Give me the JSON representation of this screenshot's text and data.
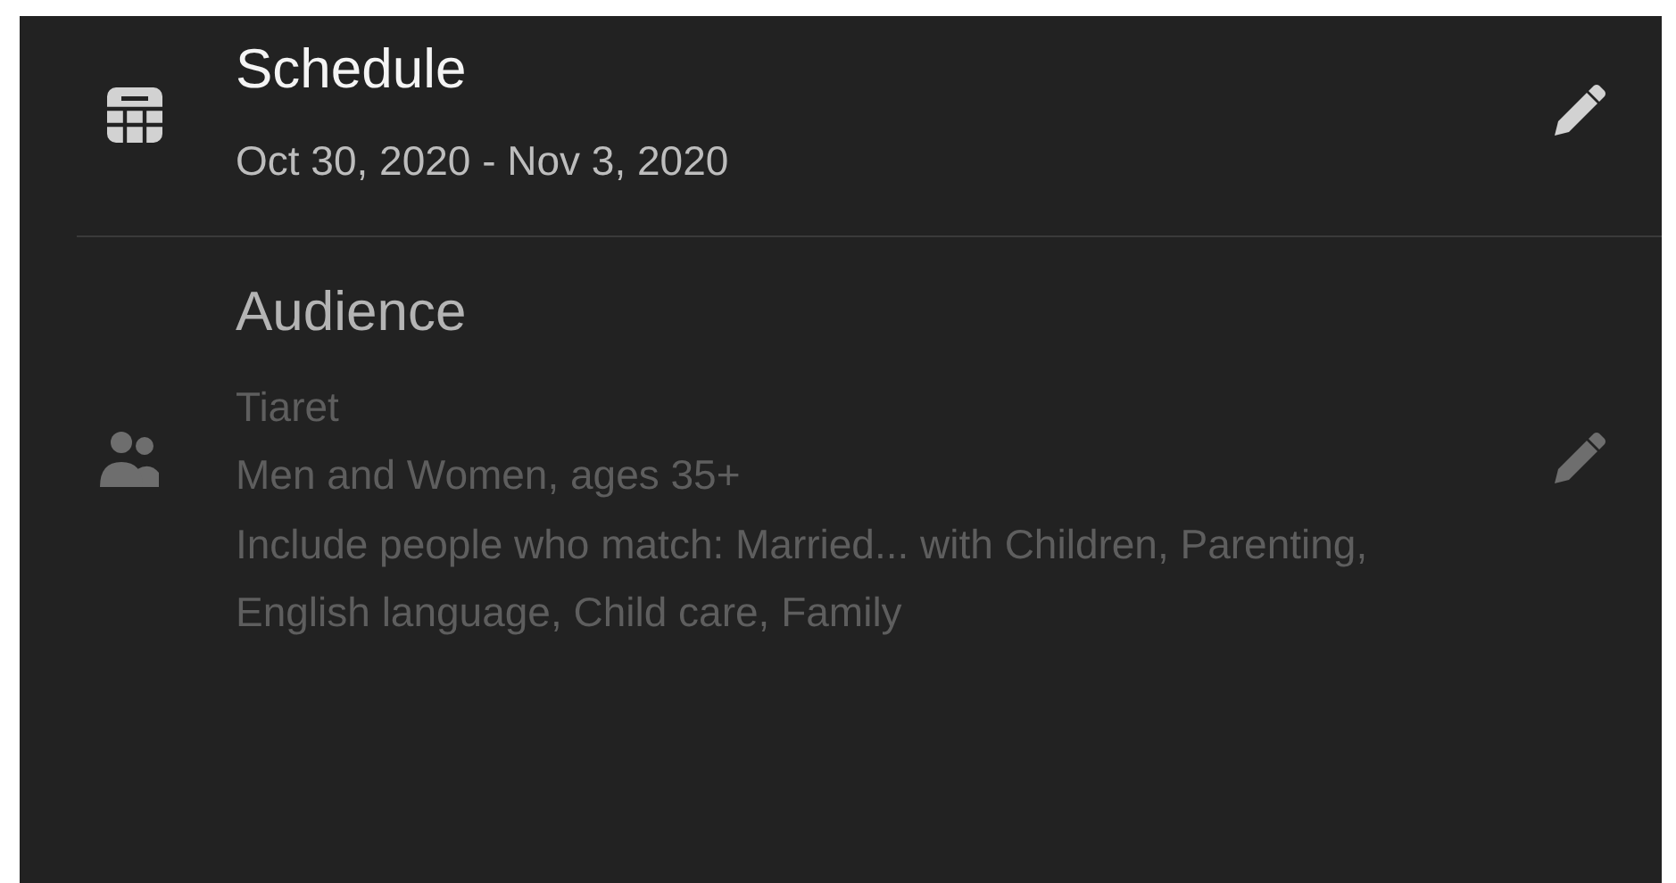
{
  "sections": [
    {
      "kind": "schedule",
      "title": "Schedule",
      "dimmed": false,
      "details": [
        "Oct 30, 2020 - Nov 3, 2020"
      ]
    },
    {
      "kind": "audience",
      "title": "Audience",
      "dimmed": true,
      "details": [
        "Tiaret",
        "Men and Women, ages 35+",
        "Include people who match: Married... with Children, Parenting, English language, Child care, Family"
      ]
    }
  ]
}
